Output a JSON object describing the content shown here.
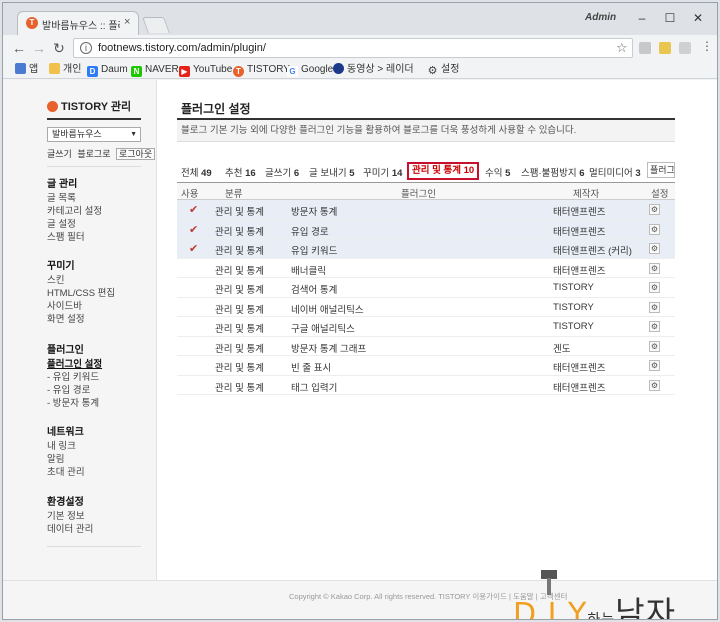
{
  "browser": {
    "tab_title": "발바름뉴우스 :: 플러그인",
    "tab_close": "×",
    "user_label": "Admin",
    "url": "footnews.tistory.com/admin/plugin/",
    "bookmarks": [
      "앱",
      "개인",
      "Daum",
      "NAVER",
      "YouTube",
      "TISTORY",
      "Google",
      "동영상 > 레이더",
      "설정"
    ]
  },
  "sidebar": {
    "logo": "TISTORY 관리",
    "blog_select": "발바름뉴우스",
    "links": [
      "글쓰기",
      "블로그로",
      "로그아웃"
    ],
    "groups": [
      {
        "head": "글 관리",
        "items": [
          "글 목록",
          "카테고리 설정",
          "글 설정",
          "스팸 필터"
        ]
      },
      {
        "head": "꾸미기",
        "items": [
          "스킨",
          "HTML/CSS 편집",
          "사이드바",
          "화면 설정"
        ]
      },
      {
        "head": "플러그인",
        "items": [
          "플러그인 설정",
          "- 유입 키워드",
          "- 유입 경로",
          "- 방문자 통계"
        ]
      },
      {
        "head": "네트워크",
        "items": [
          "내 링크",
          "알림",
          "초대 관리"
        ]
      },
      {
        "head": "환경설정",
        "items": [
          "기본 정보",
          "데이터 관리"
        ]
      }
    ]
  },
  "main": {
    "title": "플러그인 설정",
    "description": "블로그 기본 기능 외에 다양한 플러그인 기능을 활용하여 블로그를 더욱 풍성하게 사용할 수 있습니다.",
    "categories": [
      {
        "label": "전체",
        "count": "49"
      },
      {
        "label": "추천",
        "count": "16"
      },
      {
        "label": "글쓰기",
        "count": "6"
      },
      {
        "label": "글 보내기",
        "count": "5"
      },
      {
        "label": "꾸미기",
        "count": "14"
      },
      {
        "label": "관리 및 통계",
        "count": "10"
      },
      {
        "label": "수익",
        "count": "5"
      },
      {
        "label": "스팸·불펌방지",
        "count": "6"
      },
      {
        "label": "멀티미디어",
        "count": "3"
      }
    ],
    "category_overflow": "플러그",
    "columns": {
      "use": "사용",
      "category": "분류",
      "plugin": "플러그인",
      "maker": "제작자",
      "settings": "설정"
    },
    "rows": [
      {
        "on": true,
        "category": "관리 및 통계",
        "plugin": "방문자 통계",
        "maker": "태터앤프렌즈"
      },
      {
        "on": true,
        "category": "관리 및 통계",
        "plugin": "유입 경로",
        "maker": "태터앤프렌즈"
      },
      {
        "on": true,
        "category": "관리 및 통계",
        "plugin": "유입 키워드",
        "maker": "태터앤프렌즈 (커리)"
      },
      {
        "on": false,
        "category": "관리 및 통계",
        "plugin": "배너클릭",
        "maker": "태터앤프렌즈"
      },
      {
        "on": false,
        "category": "관리 및 통계",
        "plugin": "검색어 통계",
        "maker": "TISTORY"
      },
      {
        "on": false,
        "category": "관리 및 통계",
        "plugin": "네이버 애널리틱스",
        "maker": "TISTORY"
      },
      {
        "on": false,
        "category": "관리 및 통계",
        "plugin": "구글 애널리틱스",
        "maker": "TISTORY"
      },
      {
        "on": false,
        "category": "관리 및 통계",
        "plugin": "방문자 통계 그래프",
        "maker": "겐도"
      },
      {
        "on": false,
        "category": "관리 및 통계",
        "plugin": "빈 줄 표시",
        "maker": "태터앤프렌즈"
      },
      {
        "on": false,
        "category": "관리 및 통계",
        "plugin": "태그 입력기",
        "maker": "태터앤프렌즈"
      }
    ]
  },
  "footer": {
    "text": "Copyright © Kakao Corp. All rights reserved.  TISTORY  이용가이드  |  도움말  |  고객센터"
  },
  "watermark": {
    "brand": "D.I.Y",
    "mid": "하는",
    "end": "남자"
  },
  "colors": {
    "accent": "#c8102e",
    "tistory": "#e8612c",
    "row_on": "#e8edf6"
  }
}
